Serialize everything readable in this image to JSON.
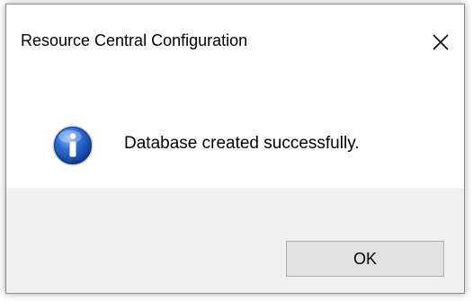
{
  "dialog": {
    "title": "Resource Central Configuration",
    "close_icon": "close-icon",
    "message": "Database created successfully.",
    "message_icon": "info-icon",
    "ok_label": "OK"
  },
  "colors": {
    "dialog_background": "#ffffff",
    "footer_background": "#f0f0f0",
    "button_background": "#e1e1e1",
    "button_border": "#adadad",
    "info_icon_blue": "#1a4fae"
  }
}
